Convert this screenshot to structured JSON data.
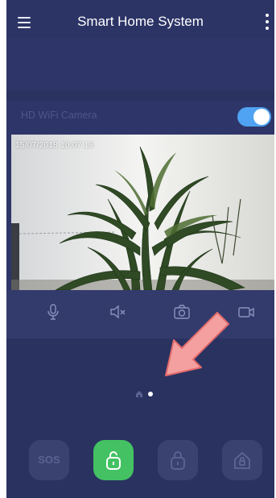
{
  "app": {
    "title": "Smart Home System"
  },
  "camera": {
    "label": "HD WiFi Camera",
    "enabled": true,
    "timestamp": "15/07/2018 10:07:13"
  },
  "controls": [
    "microphone-icon",
    "mute-icon",
    "snapshot-icon",
    "record-icon"
  ],
  "pager": {
    "pages": 2,
    "active": 2
  },
  "actions": {
    "sos_label": "SOS"
  },
  "colors": {
    "background": "#2a3260",
    "toggle_on": "#4fa3f2",
    "active_action": "#43c163",
    "arrow": "#f4a0a0"
  }
}
